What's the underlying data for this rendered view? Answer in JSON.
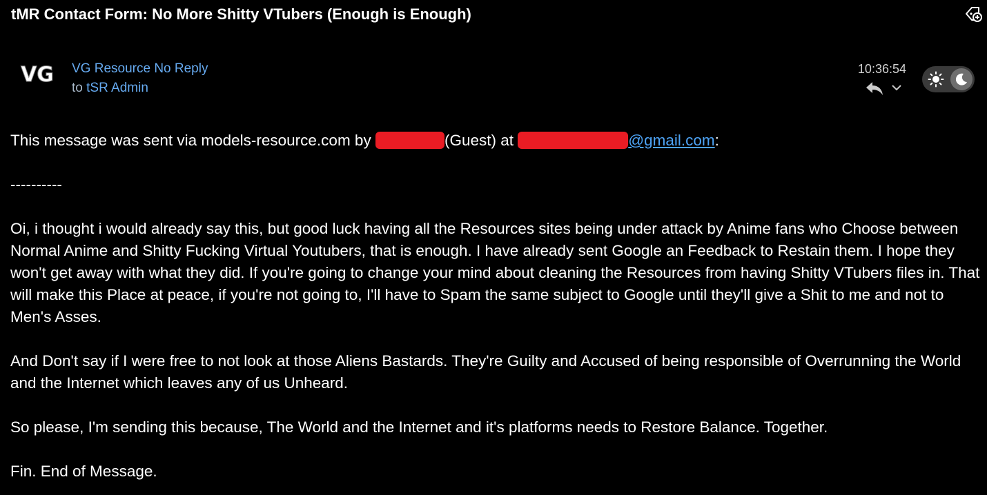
{
  "email": {
    "subject": "tMR Contact Form: No More Shitty VTubers (Enough is Enough)",
    "sender": {
      "name": "VG Resource No Reply",
      "avatar_text": "VG"
    },
    "recipient": {
      "prefix": "to",
      "name": "tSR Admin"
    },
    "time": "10:36:54",
    "icons": {
      "label": "label-add-icon",
      "reply": "reply-icon",
      "more": "chevron-down-icon",
      "sun": "sun-icon",
      "moon": "moon-icon"
    },
    "body": {
      "intro_prefix": "This message was sent via models-resource.com by ",
      "intro_guest": "(Guest) at ",
      "intro_email_domain": "@gmail.com",
      "intro_colon": ":",
      "separator": "----------",
      "paragraph_1": "Oi, i thought i would already say this, but good luck having all the Resources sites being under attack by Anime fans who Choose between Normal Anime and Shitty Fucking Virtual Youtubers, that is enough. I have already sent Google an Feedback to Restain them. I hope they won't get away with what they did. If you're going to change your mind about cleaning the Resources from having Shitty VTubers files in. That will make this Place at peace, if you're not going to, I'll have to Spam the same subject to Google until they'll give a Shit to me and not to Men's Asses.",
      "paragraph_2": "And Don't say if I were free to not look at those Aliens Bastards. They're Guilty and Accused of being responsible of Overrunning the World and the Internet which leaves any of us Unheard.",
      "paragraph_3": "So please, I'm sending this because, The World and the Internet and it's platforms needs to Restore Balance. Together.",
      "paragraph_4": "Fin. End of Message."
    },
    "colors": {
      "background": "#000000",
      "link": "#4da3f5",
      "sender": "#66aaf0",
      "redaction": "#ea1c24"
    }
  }
}
